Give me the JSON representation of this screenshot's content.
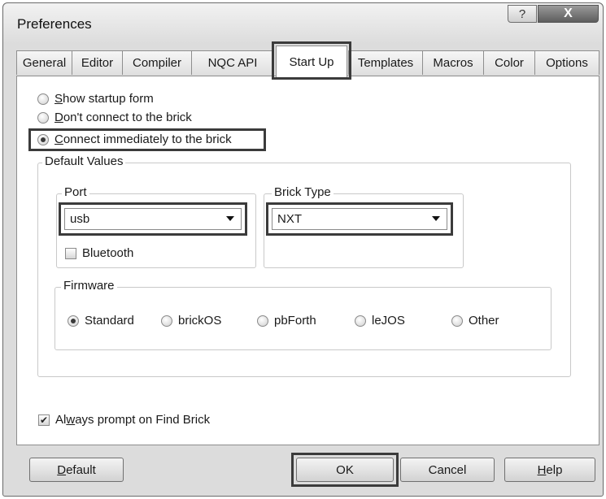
{
  "window": {
    "title": "Preferences",
    "help_glyph": "?",
    "close_glyph": "X"
  },
  "tabs": [
    {
      "label": "General"
    },
    {
      "label": "Editor"
    },
    {
      "label": "Compiler"
    },
    {
      "label": "NQC API"
    },
    {
      "label": "Start Up",
      "active": true
    },
    {
      "label": "Templates"
    },
    {
      "label": "Macros"
    },
    {
      "label": "Color"
    },
    {
      "label": "Options"
    }
  ],
  "startup": {
    "options": [
      {
        "prefix": "",
        "accel": "S",
        "rest": "how startup form",
        "selected": false
      },
      {
        "prefix": "",
        "accel": "D",
        "rest": "on't connect to the brick",
        "selected": false
      },
      {
        "prefix": "",
        "accel": "C",
        "rest": "onnect immediately to the brick",
        "selected": true
      }
    ]
  },
  "default_values": {
    "label": "Default Values",
    "port": {
      "label": "Port",
      "value": "usb"
    },
    "bluetooth": {
      "label": "Bluetooth",
      "checked": false
    },
    "brick_type": {
      "label": "Brick Type",
      "value": "NXT"
    },
    "firmware": {
      "label": "Firmware",
      "options": [
        {
          "label": "Standard",
          "selected": true
        },
        {
          "label": "brickOS",
          "selected": false
        },
        {
          "label": "pbForth",
          "selected": false
        },
        {
          "label": "leJOS",
          "selected": false
        },
        {
          "label": "Other",
          "selected": false
        }
      ]
    }
  },
  "always_prompt": {
    "prefix": "Al",
    "accel": "w",
    "rest": "ays prompt on Find Brick",
    "checked": true
  },
  "buttons": {
    "default": {
      "accel": "D",
      "rest": "efault"
    },
    "ok": "OK",
    "cancel": "Cancel",
    "help": {
      "accel": "H",
      "rest": "elp"
    }
  }
}
